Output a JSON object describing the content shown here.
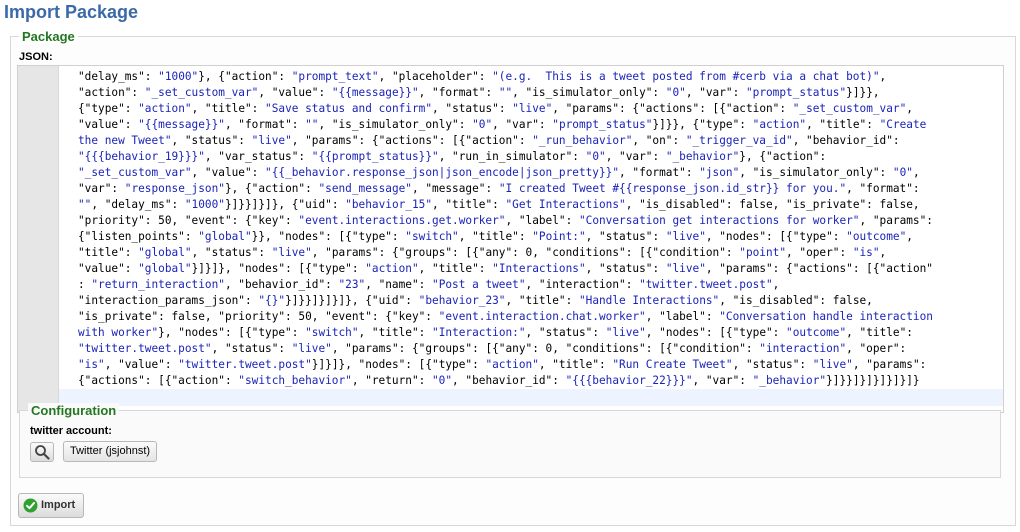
{
  "page": {
    "title": "Import Package"
  },
  "package": {
    "legend": "Package",
    "json_label": "JSON:",
    "json_segments": [
      [
        "p",
        "\"delay_ms\": "
      ],
      [
        "s",
        "\"1000\""
      ],
      [
        "p",
        "}, {"
      ],
      [
        "p",
        "\"action\": "
      ],
      [
        "s",
        "\"prompt_text\""
      ],
      [
        "p",
        ", "
      ],
      [
        "p",
        "\"placeholder\": "
      ],
      [
        "s",
        "\"(e.g.  This is a tweet posted from #cerb via a chat bot)\""
      ],
      [
        "p",
        ",\n"
      ],
      [
        "p",
        "\"action\": "
      ],
      [
        "s",
        "\"_set_custom_var\""
      ],
      [
        "p",
        ", "
      ],
      [
        "p",
        "\"value\": "
      ],
      [
        "s",
        "\"{{message}}\""
      ],
      [
        "p",
        ", "
      ],
      [
        "p",
        "\"format\": "
      ],
      [
        "s",
        "\"\""
      ],
      [
        "p",
        ", "
      ],
      [
        "p",
        "\"is_simulator_only\": "
      ],
      [
        "s",
        "\"0\""
      ],
      [
        "p",
        ", "
      ],
      [
        "p",
        "\"var\": "
      ],
      [
        "s",
        "\"prompt_status\""
      ],
      [
        "p",
        "}]}},\n"
      ],
      [
        "p",
        "{\"type\": "
      ],
      [
        "s",
        "\"action\""
      ],
      [
        "p",
        ", \"title\": "
      ],
      [
        "s",
        "\"Save status and confirm\""
      ],
      [
        "p",
        ", \"status\": "
      ],
      [
        "s",
        "\"live\""
      ],
      [
        "p",
        ", \"params\": {\"actions\": [{\"action\": "
      ],
      [
        "s",
        "\"_set_custom_var\""
      ],
      [
        "p",
        ",\n"
      ],
      [
        "p",
        "\"value\": "
      ],
      [
        "s",
        "\"{{message}}\""
      ],
      [
        "p",
        ", \"format\": "
      ],
      [
        "s",
        "\"\""
      ],
      [
        "p",
        ", \"is_simulator_only\": "
      ],
      [
        "s",
        "\"0\""
      ],
      [
        "p",
        ", \"var\": "
      ],
      [
        "s",
        "\"prompt_status\""
      ],
      [
        "p",
        "}]}}, {\"type\": "
      ],
      [
        "s",
        "\"action\""
      ],
      [
        "p",
        ", \"title\": "
      ],
      [
        "s",
        "\"Create\nthe new Tweet\""
      ],
      [
        "p",
        ", \"status\": "
      ],
      [
        "s",
        "\"live\""
      ],
      [
        "p",
        ", \"params\": {\"actions\": [{\"action\": "
      ],
      [
        "s",
        "\"_run_behavior\""
      ],
      [
        "p",
        ", \"on\": "
      ],
      [
        "s",
        "\"_trigger_va_id\""
      ],
      [
        "p",
        ", \"behavior_id\":\n"
      ],
      [
        "s",
        "\"{{{behavior_19}}}\""
      ],
      [
        "p",
        ", \"var_status\": "
      ],
      [
        "s",
        "\"{{prompt_status}}\""
      ],
      [
        "p",
        ", \"run_in_simulator\": "
      ],
      [
        "s",
        "\"0\""
      ],
      [
        "p",
        ", \"var\": "
      ],
      [
        "s",
        "\"_behavior\""
      ],
      [
        "p",
        "}, {\"action\":\n"
      ],
      [
        "s",
        "\"_set_custom_var\""
      ],
      [
        "p",
        ", \"value\": "
      ],
      [
        "s",
        "\"{{_behavior.response_json|json_encode|json_pretty}}\""
      ],
      [
        "p",
        ", \"format\": "
      ],
      [
        "s",
        "\"json\""
      ],
      [
        "p",
        ", \"is_simulator_only\": "
      ],
      [
        "s",
        "\"0\""
      ],
      [
        "p",
        ",\n"
      ],
      [
        "p",
        "\"var\": "
      ],
      [
        "s",
        "\"response_json\""
      ],
      [
        "p",
        "}, {\"action\": "
      ],
      [
        "s",
        "\"send_message\""
      ],
      [
        "p",
        ", \"message\": "
      ],
      [
        "s",
        "\"I created Tweet #{{response_json.id_str}} for you.\""
      ],
      [
        "p",
        ", \"format\":\n"
      ],
      [
        "s",
        "\"\""
      ],
      [
        "p",
        ", \"delay_ms\": "
      ],
      [
        "s",
        "\"1000\""
      ],
      [
        "p",
        "}]}}]}]}, {\"uid\": "
      ],
      [
        "s",
        "\"behavior_15\""
      ],
      [
        "p",
        ", \"title\": "
      ],
      [
        "s",
        "\"Get Interactions\""
      ],
      [
        "p",
        ", \"is_disabled\": false, \"is_private\": false,\n"
      ],
      [
        "p",
        "\"priority\": 50, \"event\": {\"key\": "
      ],
      [
        "s",
        "\"event.interactions.get.worker\""
      ],
      [
        "p",
        ", \"label\": "
      ],
      [
        "s",
        "\"Conversation get interactions for worker\""
      ],
      [
        "p",
        ", \"params\":\n"
      ],
      [
        "p",
        "{\"listen_points\": "
      ],
      [
        "s",
        "\"global\""
      ],
      [
        "p",
        "}}, \"nodes\": [{\"type\": "
      ],
      [
        "s",
        "\"switch\""
      ],
      [
        "p",
        ", \"title\": "
      ],
      [
        "s",
        "\"Point:\""
      ],
      [
        "p",
        ", \"status\": "
      ],
      [
        "s",
        "\"live\""
      ],
      [
        "p",
        ", \"nodes\": [{\"type\": "
      ],
      [
        "s",
        "\"outcome\""
      ],
      [
        "p",
        ",\n"
      ],
      [
        "p",
        "\"title\": "
      ],
      [
        "s",
        "\"global\""
      ],
      [
        "p",
        ", \"status\": "
      ],
      [
        "s",
        "\"live\""
      ],
      [
        "p",
        ", \"params\": {\"groups\": [{\"any\": 0, \"conditions\": [{\"condition\": "
      ],
      [
        "s",
        "\"point\""
      ],
      [
        "p",
        ", \"oper\": "
      ],
      [
        "s",
        "\"is\""
      ],
      [
        "p",
        ",\n"
      ],
      [
        "p",
        "\"value\": "
      ],
      [
        "s",
        "\"global\""
      ],
      [
        "p",
        "}]}]}, \"nodes\": [{\"type\": "
      ],
      [
        "s",
        "\"action\""
      ],
      [
        "p",
        ", \"title\": "
      ],
      [
        "s",
        "\"Interactions\""
      ],
      [
        "p",
        ", \"status\": "
      ],
      [
        "s",
        "\"live\""
      ],
      [
        "p",
        ", \"params\": {\"actions\": [{\"action\"\n"
      ],
      [
        "p",
        ": "
      ],
      [
        "s",
        "\"return_interaction\""
      ],
      [
        "p",
        ", \"behavior_id\": "
      ],
      [
        "s",
        "\"23\""
      ],
      [
        "p",
        ", \"name\": "
      ],
      [
        "s",
        "\"Post a tweet\""
      ],
      [
        "p",
        ", \"interaction\": "
      ],
      [
        "s",
        "\"twitter.tweet.post\""
      ],
      [
        "p",
        ",\n"
      ],
      [
        "p",
        "\"interaction_params_json\": "
      ],
      [
        "s",
        "\"{}\""
      ],
      [
        "p",
        "}]}}]}]}]}, {\"uid\": "
      ],
      [
        "s",
        "\"behavior_23\""
      ],
      [
        "p",
        ", \"title\": "
      ],
      [
        "s",
        "\"Handle Interactions\""
      ],
      [
        "p",
        ", \"is_disabled\": false,\n"
      ],
      [
        "p",
        "\"is_private\": false, \"priority\": 50, \"event\": {\"key\": "
      ],
      [
        "s",
        "\"event.interaction.chat.worker\""
      ],
      [
        "p",
        ", \"label\": "
      ],
      [
        "s",
        "\"Conversation handle interaction\nwith worker\""
      ],
      [
        "p",
        "}, \"nodes\": [{\"type\": "
      ],
      [
        "s",
        "\"switch\""
      ],
      [
        "p",
        ", \"title\": "
      ],
      [
        "s",
        "\"Interaction:\""
      ],
      [
        "p",
        ", \"status\": "
      ],
      [
        "s",
        "\"live\""
      ],
      [
        "p",
        ", \"nodes\": [{\"type\": "
      ],
      [
        "s",
        "\"outcome\""
      ],
      [
        "p",
        ", \"title\":\n"
      ],
      [
        "s",
        "\"twitter.tweet.post\""
      ],
      [
        "p",
        ", \"status\": "
      ],
      [
        "s",
        "\"live\""
      ],
      [
        "p",
        ", \"params\": {\"groups\": [{\"any\": 0, \"conditions\": [{\"condition\": "
      ],
      [
        "s",
        "\"interaction\""
      ],
      [
        "p",
        ", \"oper\":\n"
      ],
      [
        "s",
        "\"is\""
      ],
      [
        "p",
        ", \"value\": "
      ],
      [
        "s",
        "\"twitter.tweet.post\""
      ],
      [
        "p",
        "}]}]}, \"nodes\": [{\"type\": "
      ],
      [
        "s",
        "\"action\""
      ],
      [
        "p",
        ", \"title\": "
      ],
      [
        "s",
        "\"Run Create Tweet\""
      ],
      [
        "p",
        ", \"status\": "
      ],
      [
        "s",
        "\"live\""
      ],
      [
        "p",
        ", \"params\":\n"
      ],
      [
        "p",
        "{\"actions\": [{\"action\": "
      ],
      [
        "s",
        "\"switch_behavior\""
      ],
      [
        "p",
        ", \"return\": "
      ],
      [
        "s",
        "\"0\""
      ],
      [
        "p",
        ", \"behavior_id\": "
      ],
      [
        "s",
        "\"{{{behavior_22}}}\""
      ],
      [
        "p",
        ", \"var\": "
      ],
      [
        "s",
        "\"_behavior\""
      ],
      [
        "p",
        "}]}}]}]}]}]}]}"
      ]
    ]
  },
  "configuration": {
    "legend": "Configuration",
    "field_label": "twitter account:",
    "selected_account": "Twitter (jsjohnst)"
  },
  "actions": {
    "import_label": "Import"
  },
  "colors": {
    "title": "#3a6aa8",
    "legend": "#227722",
    "string": "#1b24b8",
    "check": "#2fa12f"
  }
}
